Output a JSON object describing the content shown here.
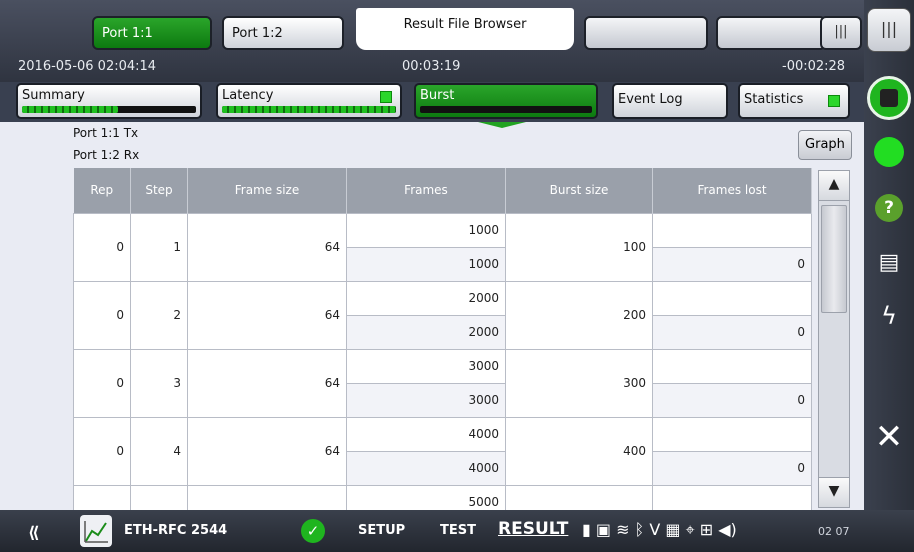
{
  "header": {
    "port_tabs": [
      "Port 1:1",
      "Port 1:2"
    ],
    "file_browser": "Result File Browser",
    "date_time": "2016-05-06 02:04:14",
    "elapsed": "00:03:19",
    "remaining": "-00:02:28"
  },
  "result_tabs": [
    {
      "label": "Summary",
      "progress": 0.55
    },
    {
      "label": "Latency",
      "progress": 1.0,
      "status": "ok"
    },
    {
      "label": "Burst",
      "progress": 0.0,
      "active": true
    },
    {
      "label": "Event Log"
    },
    {
      "label": "Statistics",
      "status": "ok"
    }
  ],
  "content": {
    "tx_label": "Port 1:1 Tx",
    "rx_label": "Port 1:2 Rx",
    "graph_label": "Graph",
    "columns": [
      "Rep",
      "Step",
      "Frame size",
      "Frames",
      "Burst size",
      "Frames lost"
    ],
    "rows": [
      {
        "rep": "0",
        "step": "1",
        "frame_size": "64",
        "frames_tx": "1000",
        "frames_rx": "1000",
        "burst_size": "100",
        "frames_lost": "0"
      },
      {
        "rep": "0",
        "step": "2",
        "frame_size": "64",
        "frames_tx": "2000",
        "frames_rx": "2000",
        "burst_size": "200",
        "frames_lost": "0"
      },
      {
        "rep": "0",
        "step": "3",
        "frame_size": "64",
        "frames_tx": "3000",
        "frames_rx": "3000",
        "burst_size": "300",
        "frames_lost": "0"
      },
      {
        "rep": "0",
        "step": "4",
        "frame_size": "64",
        "frames_tx": "4000",
        "frames_rx": "4000",
        "burst_size": "400",
        "frames_lost": "0"
      }
    ],
    "partial_row": {
      "frames_tx": "5000"
    }
  },
  "bottom": {
    "app_name": "ETH-RFC 2544",
    "setup": "SETUP",
    "test": "TEST",
    "result": "RESULT",
    "time": "02 07"
  },
  "colors": {
    "accent_green": "#1fa51f",
    "status_green": "#2bd62b"
  }
}
